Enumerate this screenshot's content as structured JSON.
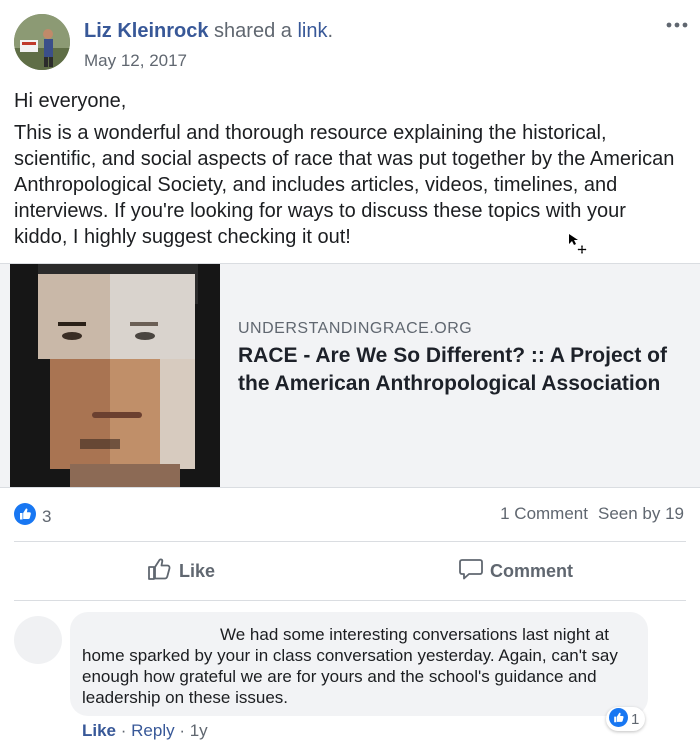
{
  "post": {
    "author": "Liz Kleinrock",
    "action_text": " shared a ",
    "action_link": "link",
    "action_end": ".",
    "date": "May 12, 2017",
    "more_icon": "ellipsis-icon",
    "greeting": "Hi everyone,",
    "body": "This is a wonderful and thorough resource explaining the historical, scientific, and social aspects of race that was put together by the American Anthropological Society, and includes articles, videos, timelines, and interviews. If you're looking for ways to discuss these topics with your kiddo, I highly suggest checking it out!"
  },
  "link_preview": {
    "domain": "UNDERSTANDINGRACE.ORG",
    "title": "RACE - Are We So Different? :: A Project of the American Anthropological Association"
  },
  "engagement": {
    "reaction_count": "3",
    "comments": "1 Comment",
    "seen": "Seen by 19"
  },
  "actions": {
    "like": "Like",
    "comment": "Comment"
  },
  "comment": {
    "text": "We had some interesting conversations last night at home sparked by your in class conversation yesterday. Again, can't say enough how grateful we are for yours and the school's guidance and leadership on these issues.",
    "reaction_count": "1",
    "like": "Like",
    "sep1": " · ",
    "reply": "Reply",
    "sep2": " · ",
    "age": "1y"
  },
  "colors": {
    "link_blue": "#385898",
    "like_blue": "#1877f2",
    "secondary_text": "#606770"
  }
}
